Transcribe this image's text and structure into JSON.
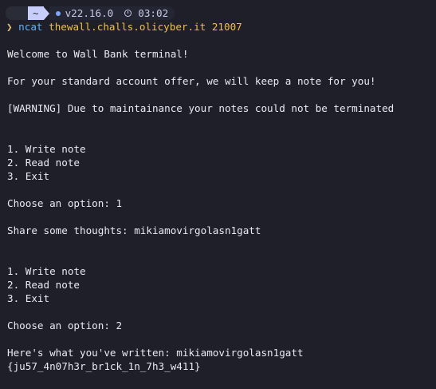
{
  "prompt": {
    "apple_glyph": "",
    "dir": "~",
    "node_version": "v22.16.0",
    "time": "03:02"
  },
  "command": {
    "name": "ncat",
    "args": "thewall.challs.olicyber.it 21007"
  },
  "output": {
    "l1": "Welcome to Wall Bank terminal!",
    "l2": "For your standard account offer, we will keep a note for you!",
    "l3": "[WARNING] Due to maintainance your notes could not be terminated",
    "menu1_1": "1. Write note",
    "menu1_2": "2. Read note",
    "menu1_3": "3. Exit",
    "choose1": "Choose an option: 1",
    "share": "Share some thoughts: mikiamovirgolasn1gatt",
    "menu2_1": "1. Write note",
    "menu2_2": "2. Read note",
    "menu2_3": "3. Exit",
    "choose2": "Choose an option: 2",
    "written": "Here's what you've written: mikiamovirgolasn1gatt",
    "flag": "{ju57_4n07h3r_br1ck_1n_7h3_w411}"
  }
}
